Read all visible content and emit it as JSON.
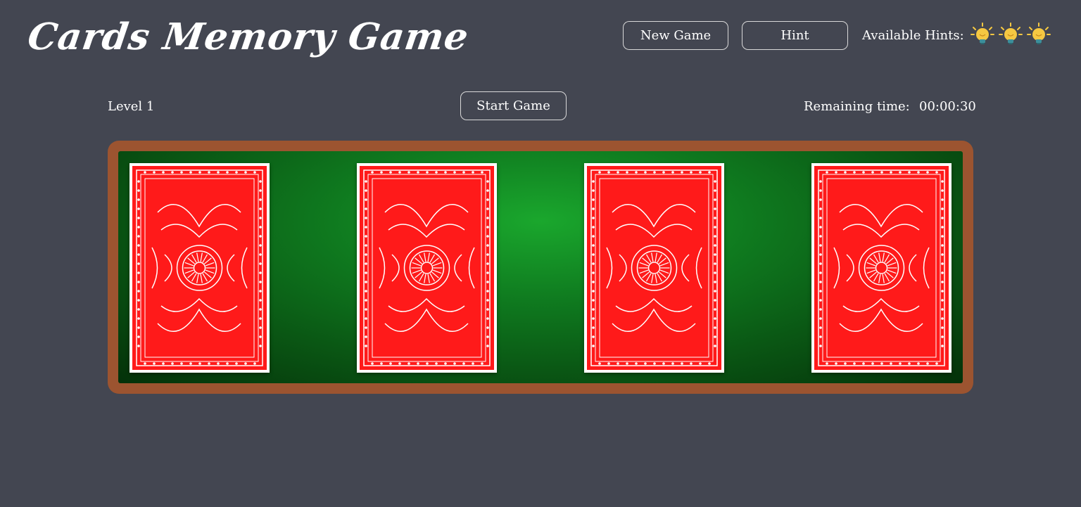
{
  "header": {
    "title": "Cards Memory Game",
    "new_game_label": "New Game",
    "hint_label": "Hint",
    "available_hints_label": "Available Hints:",
    "hint_icons": [
      "lightbulb-icon",
      "lightbulb-icon",
      "lightbulb-icon"
    ]
  },
  "status": {
    "level": "Level 1",
    "start_label": "Start Game",
    "remaining_label": "Remaining time:",
    "remaining_value": "00:00:30"
  },
  "board": {
    "cards": [
      {
        "state": "face-down"
      },
      {
        "state": "face-down"
      },
      {
        "state": "face-down"
      },
      {
        "state": "face-down"
      }
    ]
  },
  "colors": {
    "background": "#434651",
    "board_frame": "#9c5430",
    "felt": "#0f7a1f",
    "card_back": "#ff1a1a",
    "bulb": "#f5c842"
  }
}
